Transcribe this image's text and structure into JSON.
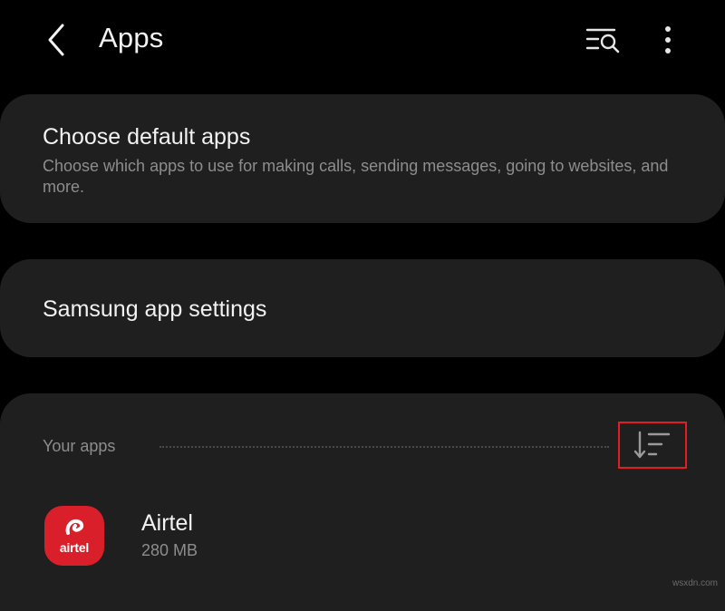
{
  "header": {
    "title": "Apps",
    "back_icon": "chevron-left-icon",
    "search_icon": "list-search-icon",
    "more_icon": "more-vertical-icon"
  },
  "default_apps": {
    "title": "Choose default apps",
    "description": "Choose which apps to use for making calls, sending messages, going to websites, and more."
  },
  "samsung_settings": {
    "title": "Samsung app settings"
  },
  "your_apps": {
    "label": "Your apps",
    "sort_icon": "sort-filter-icon",
    "highlight_color": "#e01e24",
    "items": [
      {
        "name": "Airtel",
        "size": "280 MB",
        "icon_text": "airtel",
        "icon_color": "#d9202a"
      }
    ]
  },
  "watermark": "wsxdn.com",
  "colors": {
    "background": "#000000",
    "card": "#1f1f1f",
    "primary_text": "#f2f2f2",
    "secondary_text": "#8d8d8d"
  }
}
